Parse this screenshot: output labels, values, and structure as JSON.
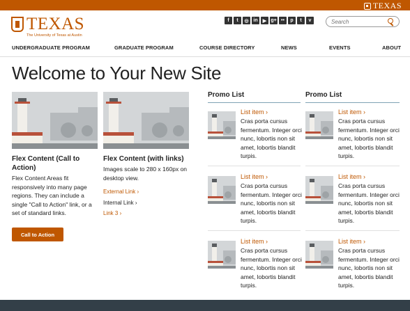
{
  "topbar": {
    "brand": "TEXAS"
  },
  "logo": {
    "word": "TEXAS",
    "sub": "The University of Texas at Austin"
  },
  "social_icons": [
    {
      "name": "facebook-icon",
      "glyph": "f"
    },
    {
      "name": "twitter-icon",
      "glyph": "t"
    },
    {
      "name": "instagram-icon",
      "glyph": "◎"
    },
    {
      "name": "linkedin-icon",
      "glyph": "in"
    },
    {
      "name": "youtube-icon",
      "glyph": "▶"
    },
    {
      "name": "googleplus-icon",
      "glyph": "g+"
    },
    {
      "name": "flickr-icon",
      "glyph": "••"
    },
    {
      "name": "pinterest-icon",
      "glyph": "p"
    },
    {
      "name": "tumblr-icon",
      "glyph": "t"
    },
    {
      "name": "vimeo-icon",
      "glyph": "v"
    }
  ],
  "search": {
    "placeholder": "Search"
  },
  "nav": [
    "UNDERGRADUATE PROGRAM",
    "GRADUATE PROGRAM",
    "COURSE DIRECTORY",
    "NEWS",
    "EVENTS",
    "ABOUT"
  ],
  "page_title": "Welcome to Your New Site",
  "card1": {
    "heading": "Flex Content (Call to Action)",
    "body": "Flex Content Areas fit responsively into many page regions. They can include a single \"Call to Action\" link, or a set of standard links.",
    "cta": "Call to Action"
  },
  "card2": {
    "heading": "Flex Content (with links)",
    "body": "Images scale to 280 x 160px on desktop view.",
    "links": [
      "External Link",
      "Internal Link",
      "Link 3"
    ]
  },
  "promo": {
    "heading": "Promo List",
    "item_title": "List item",
    "item_text": "Cras porta cursus fermentum. Integer orci nunc, lobortis non sit amet, lobortis blandit turpis."
  },
  "colors": {
    "accent": "#bf5700",
    "footer": "#333f48",
    "promo_rule": "#7fa2b5"
  }
}
